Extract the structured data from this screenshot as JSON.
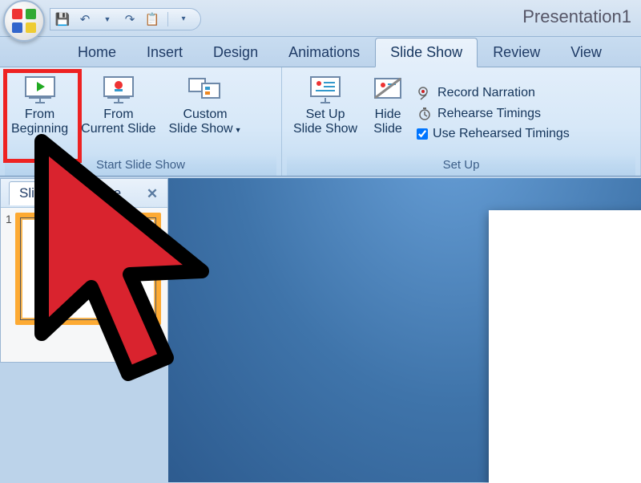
{
  "title": "Presentation1",
  "qat": {
    "save": "💾",
    "undo": "↶",
    "redo": "↷",
    "repeat": "📋",
    "more": "▾"
  },
  "tabs": [
    "Home",
    "Insert",
    "Design",
    "Animations",
    "Slide Show",
    "Review",
    "View"
  ],
  "active_tab": "Slide Show",
  "ribbon": {
    "groups": [
      {
        "name": "Start Slide Show",
        "buttons": [
          {
            "id": "from-beginning",
            "label": "From\nBeginning",
            "dropdown": false
          },
          {
            "id": "from-current",
            "label": "From\nCurrent Slide",
            "dropdown": false
          },
          {
            "id": "custom-show",
            "label": "Custom\nSlide Show",
            "dropdown": true
          }
        ]
      },
      {
        "name": "Set Up",
        "buttons": [
          {
            "id": "set-up-show",
            "label": "Set Up\nSlide Show",
            "dropdown": false
          },
          {
            "id": "hide-slide",
            "label": "Hide\nSlide",
            "dropdown": false
          }
        ],
        "items": [
          {
            "id": "record-narration",
            "label": "Record Narration",
            "icon": "🎙"
          },
          {
            "id": "rehearse-timings",
            "label": "Rehearse Timings",
            "icon": "⏱"
          },
          {
            "id": "use-rehearsed",
            "label": "Use Rehearsed Timings",
            "checkbox": true,
            "checked": true
          }
        ]
      }
    ]
  },
  "slides_pane": {
    "tabs": [
      "Slides",
      "Outline"
    ],
    "active": "Slides",
    "close": "✕",
    "thumbs": [
      {
        "num": "1"
      }
    ]
  }
}
